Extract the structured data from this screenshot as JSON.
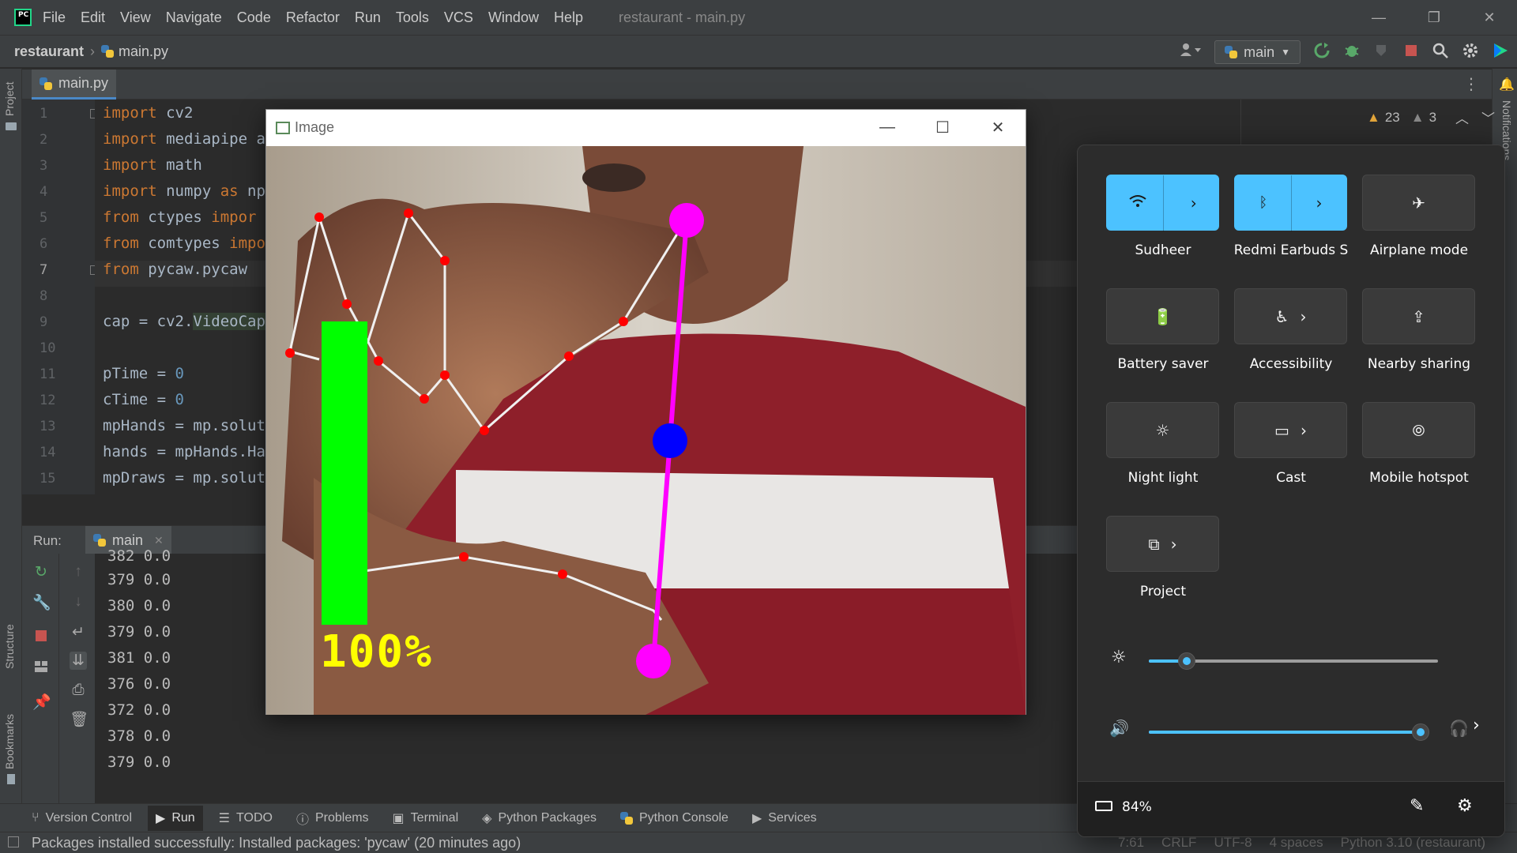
{
  "app": {
    "logo_text": "PC",
    "menu": [
      "File",
      "Edit",
      "View",
      "Navigate",
      "Code",
      "Refactor",
      "Run",
      "Tools",
      "VCS",
      "Window",
      "Help"
    ],
    "window_title": "restaurant - main.py",
    "win_minimize": "—",
    "win_maximize": "❐",
    "win_close": "✕"
  },
  "navbar": {
    "project": "restaurant",
    "separator": "›",
    "file": "main.py",
    "run_config": "main"
  },
  "left_strip": {
    "project_label": "Project",
    "structure_label": "Structure",
    "bookmarks_label": "Bookmarks"
  },
  "right_strip": {
    "notifications_label": "Notifications"
  },
  "editor": {
    "tab_label": "main.py",
    "tab_close": "✕",
    "warnings": "23",
    "weak_warnings": "3",
    "line_numbers": [
      "1",
      "2",
      "3",
      "4",
      "5",
      "6",
      "7",
      "8",
      "9",
      "10",
      "11",
      "12",
      "13",
      "14",
      "15"
    ],
    "lines": [
      {
        "kw": "import",
        "rest": " cv2"
      },
      {
        "kw": "import",
        "rest": " mediapipe a"
      },
      {
        "kw": "import",
        "rest": " math"
      },
      {
        "kw": "import",
        "rest": " numpy ",
        "kw2": "as",
        "rest2": " np"
      },
      {
        "kw": "from",
        "rest": " ctypes ",
        "kw2": "impor",
        "rest2": ""
      },
      {
        "kw": "from",
        "rest": " comtypes ",
        "kw2": "impo",
        "rest2": ""
      },
      {
        "kw": "from",
        "rest": " pycaw.pycaw ",
        "kw2": "",
        "rest2": ""
      },
      {
        "kw": "",
        "rest": ""
      },
      {
        "kw": "",
        "rest": "cap = cv2.",
        "hl": "VideoCap"
      },
      {
        "kw": "",
        "rest": ""
      },
      {
        "kw": "",
        "rest": "pTime = ",
        "num": "0"
      },
      {
        "kw": "",
        "rest": "cTime = ",
        "num": "0"
      },
      {
        "kw": "",
        "rest": "mpHands = mp.solut"
      },
      {
        "kw": "",
        "rest": "hands = mpHands.Ha"
      },
      {
        "kw": "",
        "rest": "mpDraws = mp.solut"
      }
    ]
  },
  "run": {
    "label": "Run:",
    "tab": "main",
    "tab_close": "✕",
    "output": [
      "382 0.0",
      "379  0.0",
      "380  0.0",
      "379  0.0",
      "381  0.0",
      "376  0.0",
      "372  0.0",
      "378  0.0",
      "379  0.0"
    ]
  },
  "bottom_tools": {
    "version_control": "Version Control",
    "run": "Run",
    "todo": "TODO",
    "problems": "Problems",
    "terminal": "Terminal",
    "python_packages": "Python Packages",
    "python_console": "Python Console",
    "services": "Services"
  },
  "status": {
    "message": "Packages installed successfully: Installed packages: 'pycaw' (20 minutes ago)",
    "position": "7:61",
    "line_sep": "CRLF",
    "encoding": "UTF-8",
    "indent": "4 spaces",
    "interpreter": "Python 3.10 (restaurant)"
  },
  "image_window": {
    "title": "Image",
    "volume_text": "100%",
    "volume_level": 1.0,
    "colors": {
      "bar": "#00ff00",
      "text": "#ffff00",
      "tip": "#ff00ff",
      "mid": "#0000ff",
      "landmark": "#ff0000"
    }
  },
  "quick_settings": {
    "tiles": [
      {
        "label": "Sudheer",
        "icon": "wifi-icon",
        "on": true
      },
      {
        "label": "Redmi Earbuds S",
        "icon": "bluetooth-icon",
        "on": true
      },
      {
        "label": "Airplane mode",
        "icon": "airplane-icon",
        "on": false
      },
      {
        "label": "Battery saver",
        "icon": "battery-saver-icon",
        "on": false
      },
      {
        "label": "Accessibility",
        "icon": "accessibility-icon",
        "on": false
      },
      {
        "label": "Nearby sharing",
        "icon": "share-icon",
        "on": false
      },
      {
        "label": "Night light",
        "icon": "brightness-icon",
        "on": false
      },
      {
        "label": "Cast",
        "icon": "cast-icon",
        "on": false
      },
      {
        "label": "Mobile hotspot",
        "icon": "hotspot-icon",
        "on": false
      },
      {
        "label": "Project",
        "icon": "project-icon",
        "on": false
      }
    ],
    "brightness_level": 0.13,
    "volume_level": 1.0,
    "battery": "84%",
    "accent": "#4cc2ff"
  }
}
